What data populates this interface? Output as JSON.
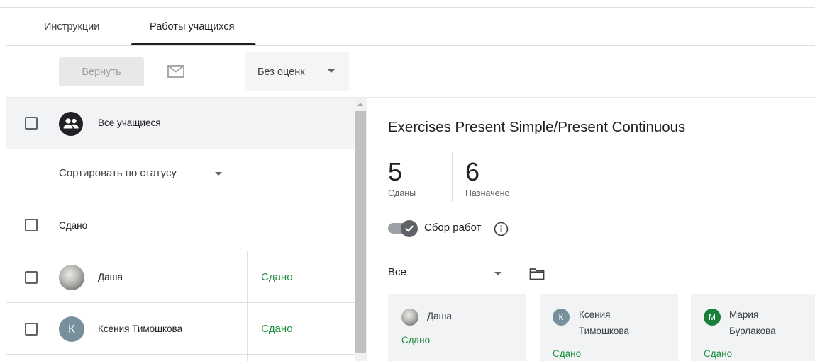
{
  "tabs": [
    {
      "label": "Инструкции"
    },
    {
      "label": "Работы учащихся"
    }
  ],
  "toolbar": {
    "return_label": "Вернуть",
    "mail_icon": "mail-icon",
    "grade_select": "Без оценк"
  },
  "left": {
    "all_students_label": "Все учащиеся",
    "sort_label": "Сортировать по статусу",
    "section_label": "Сдано",
    "students": [
      {
        "name": "Даша",
        "status": "Сдано",
        "avatar": "photo"
      },
      {
        "name": "Ксения Тимошкова",
        "status": "Сдано",
        "avatar": "letter",
        "letter": "К",
        "color": "#78909c"
      }
    ]
  },
  "right": {
    "title": "Exercises Present Simple/Present Continuous",
    "submitted_count": "5",
    "submitted_label": "Сданы",
    "assigned_count": "6",
    "assigned_label": "Назначено",
    "toggle_label": "Сбор работ",
    "filter_label": "Все",
    "cards": [
      {
        "name_line1": "Даша",
        "name_line2": "",
        "status": "Сдано",
        "avatar": "photo"
      },
      {
        "name_line1": "Ксения",
        "name_line2": "Тимошкова",
        "status": "Сдано",
        "avatar": "letter",
        "letter": "К",
        "color": "#78909c"
      },
      {
        "name_line1": "Мария",
        "name_line2": "Бурлакова",
        "status": "Сдано",
        "avatar": "letter",
        "letter": "М",
        "color": "#188038"
      }
    ]
  },
  "colors": {
    "accent_text": "#202124",
    "status_green": "#1e8e3e",
    "selected_row_bg": "#f1f3f4"
  }
}
